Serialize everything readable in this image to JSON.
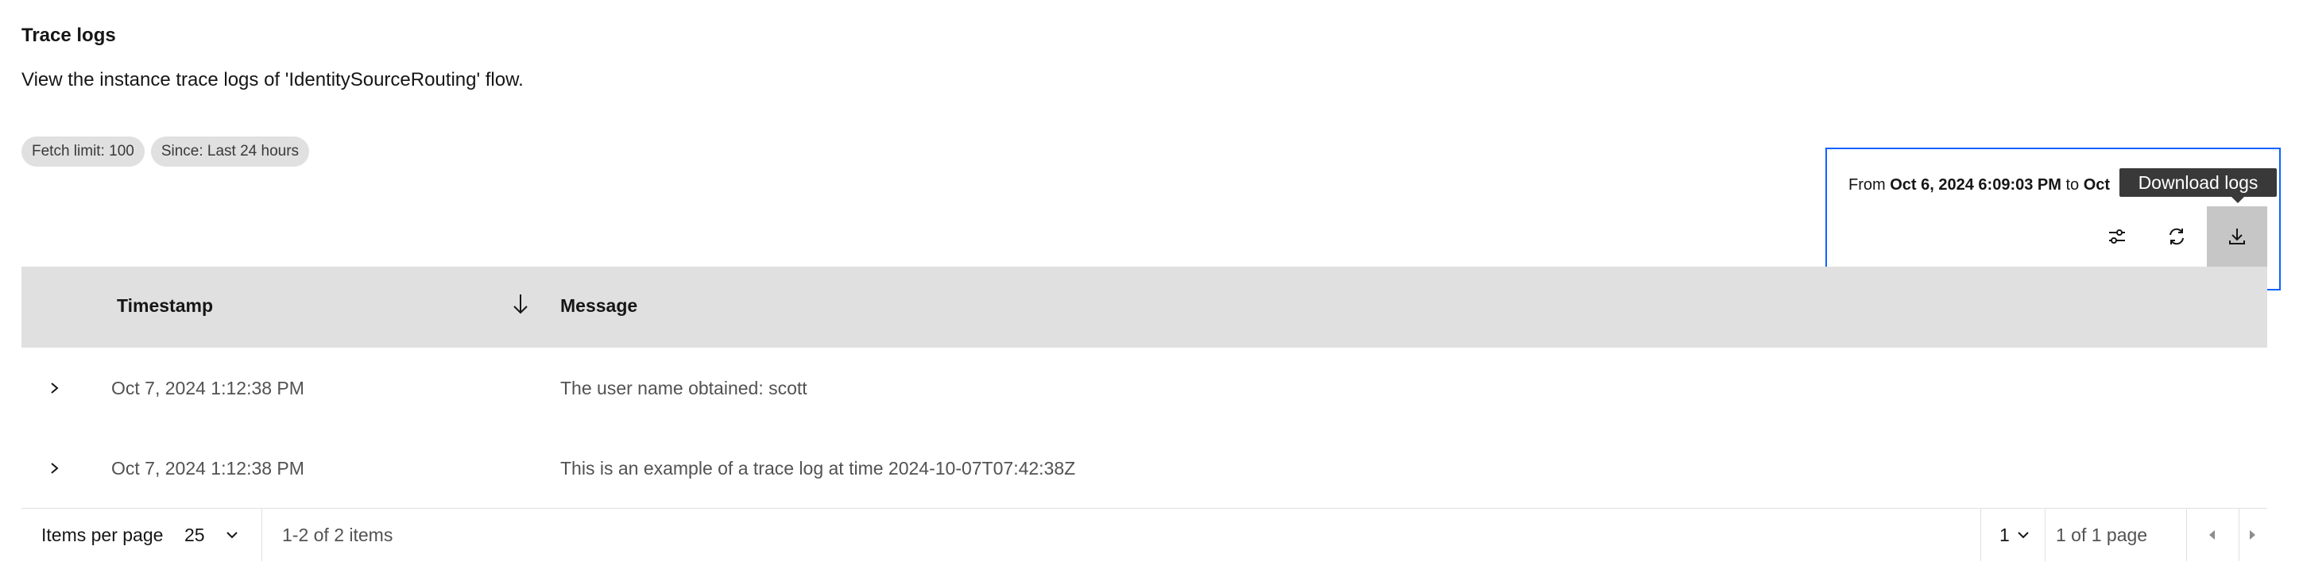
{
  "header": {
    "title": "Trace logs",
    "description": "View the instance trace logs of 'IdentitySourceRouting' flow."
  },
  "filters": {
    "chips": [
      "Fetch limit: 100",
      "Since: Last 24 hours"
    ]
  },
  "toolbar": {
    "range_prefix": "From",
    "range_from": "Oct 6, 2024 6:09:03 PM",
    "range_mid": "to",
    "range_to": "Oct",
    "tooltip": "Download logs",
    "icons": [
      "settings-adjust-icon",
      "refresh-icon",
      "download-icon"
    ]
  },
  "table": {
    "columns": [
      "Timestamp",
      "Message"
    ],
    "rows": [
      {
        "timestamp": "Oct 7, 2024 1:12:38 PM",
        "message": "The user name obtained: scott"
      },
      {
        "timestamp": "Oct 7, 2024 1:12:38 PM",
        "message": "This is an example of a trace log at time 2024-10-07T07:42:38Z"
      }
    ]
  },
  "pagination": {
    "items_per_page_label": "Items per page",
    "items_per_page_value": "25",
    "range_text": "1-2 of 2 items",
    "page_value": "1",
    "page_of": "1 of 1 page"
  },
  "colors": {
    "accent": "#0f62fe",
    "header_bg": "#e0e0e0",
    "tooltip_bg": "#393939"
  }
}
